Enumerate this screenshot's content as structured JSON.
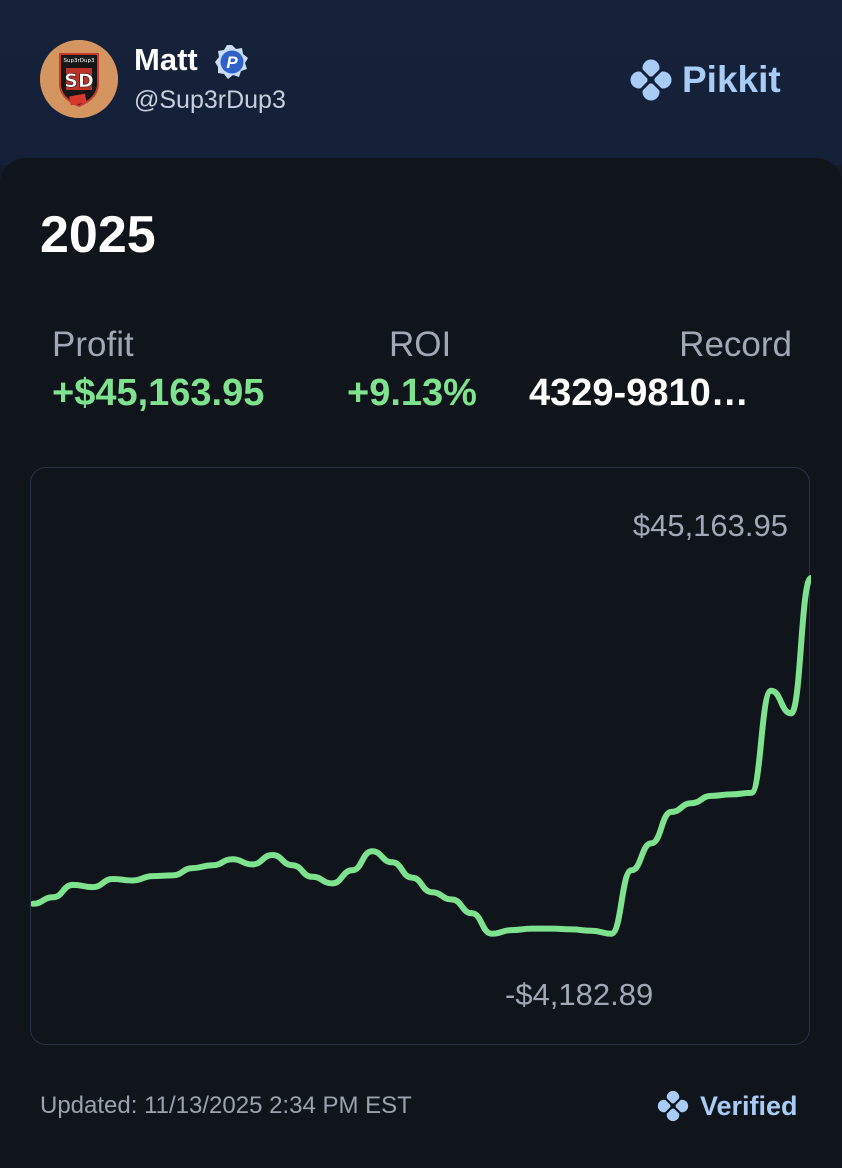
{
  "profile": {
    "name": "Matt",
    "handle": "@Sup3rDup3",
    "verified_badge_letter": "P",
    "avatar_text": "Sup3rDup3",
    "avatar_initials": "SD",
    "avatar_icon": "shield-logo"
  },
  "brand": {
    "name": "Pikkit",
    "icon": "clover-icon",
    "color": "#a9ccf7"
  },
  "card": {
    "title": "2025",
    "stats": [
      {
        "label": "Profit",
        "value": "+$45,163.95"
      },
      {
        "label": "ROI",
        "value": "+9.13%"
      },
      {
        "label": "Record",
        "value": "4329-9810…"
      }
    ],
    "chart_max_label": "$45,163.95",
    "chart_min_label": "-$4,182.89",
    "footer_updated": "Updated: 11/13/2025 2:34 PM EST",
    "footer_verified": "Verified"
  },
  "colors": {
    "positive": "#7ee28f",
    "background": "#10141b",
    "header": "#142038"
  },
  "chart_data": {
    "type": "line",
    "title": "",
    "xlabel": "",
    "ylabel": "",
    "ylim": [
      -4182.89,
      45163.95
    ],
    "grid": false,
    "legend": "none",
    "series": [
      {
        "color": "#7ee28f",
        "values": [
          500,
          1400,
          3100,
          2800,
          3900,
          3700,
          4300,
          4400,
          5400,
          5800,
          6600,
          5900,
          7200,
          5800,
          4200,
          3300,
          5100,
          7700,
          6200,
          4100,
          2100,
          1100,
          -800,
          -3600,
          -3100,
          -2900,
          -2900,
          -3000,
          -3200,
          -3600,
          5100,
          8800,
          13100,
          14300,
          15300,
          15500,
          15700,
          29700,
          26600,
          45163.95
        ]
      }
    ]
  }
}
